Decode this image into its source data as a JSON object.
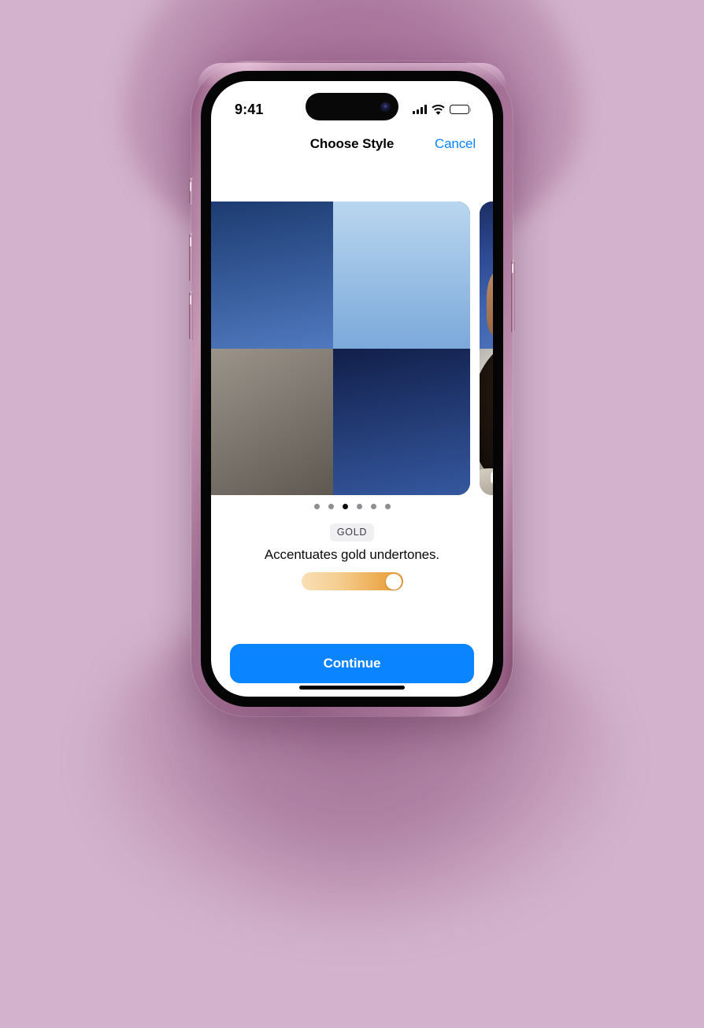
{
  "background": {
    "color": "#d2b2cc"
  },
  "device": {
    "frame_color": "#9a6689",
    "buttons": [
      {
        "name": "silent-switch"
      },
      {
        "name": "volume-up-button"
      },
      {
        "name": "volume-down-button"
      },
      {
        "name": "power-button"
      }
    ]
  },
  "status_bar": {
    "time": "9:41",
    "icons": [
      "cellular-signal-icon",
      "wifi-icon",
      "battery-icon"
    ],
    "battery_level_percent": 100
  },
  "nav_bar": {
    "title": "Choose Style",
    "cancel_label": "Cancel",
    "cancel_color": "#0a84ff"
  },
  "carousel": {
    "current_index": 2,
    "total": 6,
    "badge_icon": "photos-stack-icon",
    "cards": [
      {
        "name": "style-card-prev",
        "label": ""
      },
      {
        "name": "style-card-gold",
        "label": "GOLD",
        "photos": [
          {
            "name": "photo-sunglasses-blue-wall"
          },
          {
            "name": "photo-sky-white-dress"
          },
          {
            "name": "photo-closeup-portrait"
          },
          {
            "name": "photo-striped-dress-blue-wall"
          }
        ]
      },
      {
        "name": "style-card-next",
        "label": ""
      }
    ]
  },
  "pagination": {
    "dots": [
      {
        "active": false
      },
      {
        "active": false
      },
      {
        "active": true
      },
      {
        "active": false
      },
      {
        "active": false
      },
      {
        "active": false
      }
    ],
    "inactive_color": "#8e8e93",
    "active_color": "#0a0a0a"
  },
  "tone": {
    "badge_label": "GOLD",
    "badge_bg": "#f0f0f2",
    "badge_text_color": "#3c3c43",
    "description": "Accentuates gold undertones."
  },
  "slider": {
    "name": "intensity-slider",
    "value_percent": 100,
    "gradient_from": "#f9dfb4",
    "gradient_to": "#e79a2f",
    "knob_color": "#ffffff"
  },
  "primary_action": {
    "label": "Continue",
    "color": "#0a84ff",
    "text_color": "#ffffff"
  },
  "home_indicator": {
    "name": "home-indicator"
  }
}
